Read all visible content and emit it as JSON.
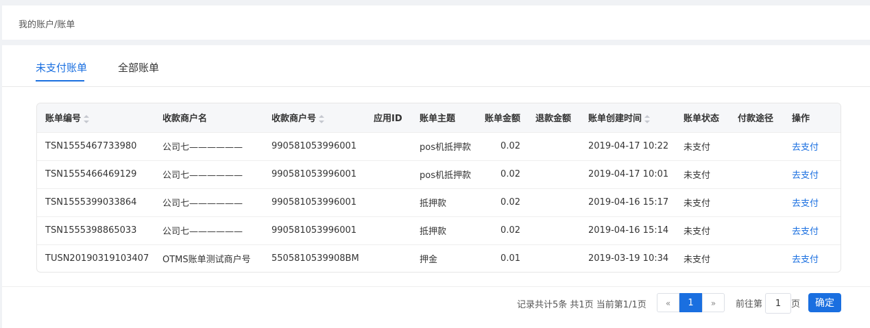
{
  "breadcrumb": "我的账户/账单",
  "tabs": [
    {
      "label": "未支付账单",
      "active": true
    },
    {
      "label": "全部账单",
      "active": false
    }
  ],
  "table": {
    "headers": [
      "账单编号",
      "收款商户名",
      "收款商户号",
      "应用ID",
      "账单主题",
      "账单金额",
      "退款金额",
      "账单创建时间",
      "账单状态",
      "付款途径",
      "操作"
    ],
    "rows": [
      [
        "TSN1555467733980",
        "公司七——————",
        "990581053996001",
        "",
        "pos机抵押款",
        "0.02",
        "",
        "2019-04-17 10:22",
        "未支付",
        "",
        "去支付"
      ],
      [
        "TSN1555466469129",
        "公司七——————",
        "990581053996001",
        "",
        "pos机抵押款",
        "0.02",
        "",
        "2019-04-17 10:01",
        "未支付",
        "",
        "去支付"
      ],
      [
        "TSN1555399033864",
        "公司七——————",
        "990581053996001",
        "",
        "抵押款",
        "0.02",
        "",
        "2019-04-16 15:17",
        "未支付",
        "",
        "去支付"
      ],
      [
        "TSN1555398865033",
        "公司七——————",
        "990581053996001",
        "",
        "抵押款",
        "0.02",
        "",
        "2019-04-16 15:14",
        "未支付",
        "",
        "去支付"
      ],
      [
        "TUSN20190319103407",
        "OTMS账单测试商户号",
        "5505810539908BM",
        "",
        "押金",
        "0.01",
        "",
        "2019-03-19 10:34",
        "未支付",
        "",
        "去支付"
      ]
    ]
  },
  "pagination": {
    "summary": "记录共计5条 共1页 当前第1/1页",
    "prev": "«",
    "current_page": "1",
    "next": "»",
    "goto_label": "前往第",
    "goto_value": "1",
    "goto_unit": "页",
    "confirm": "确定"
  },
  "colors": {
    "accent": "#1a6fe0",
    "background": "#f0f2f5"
  }
}
